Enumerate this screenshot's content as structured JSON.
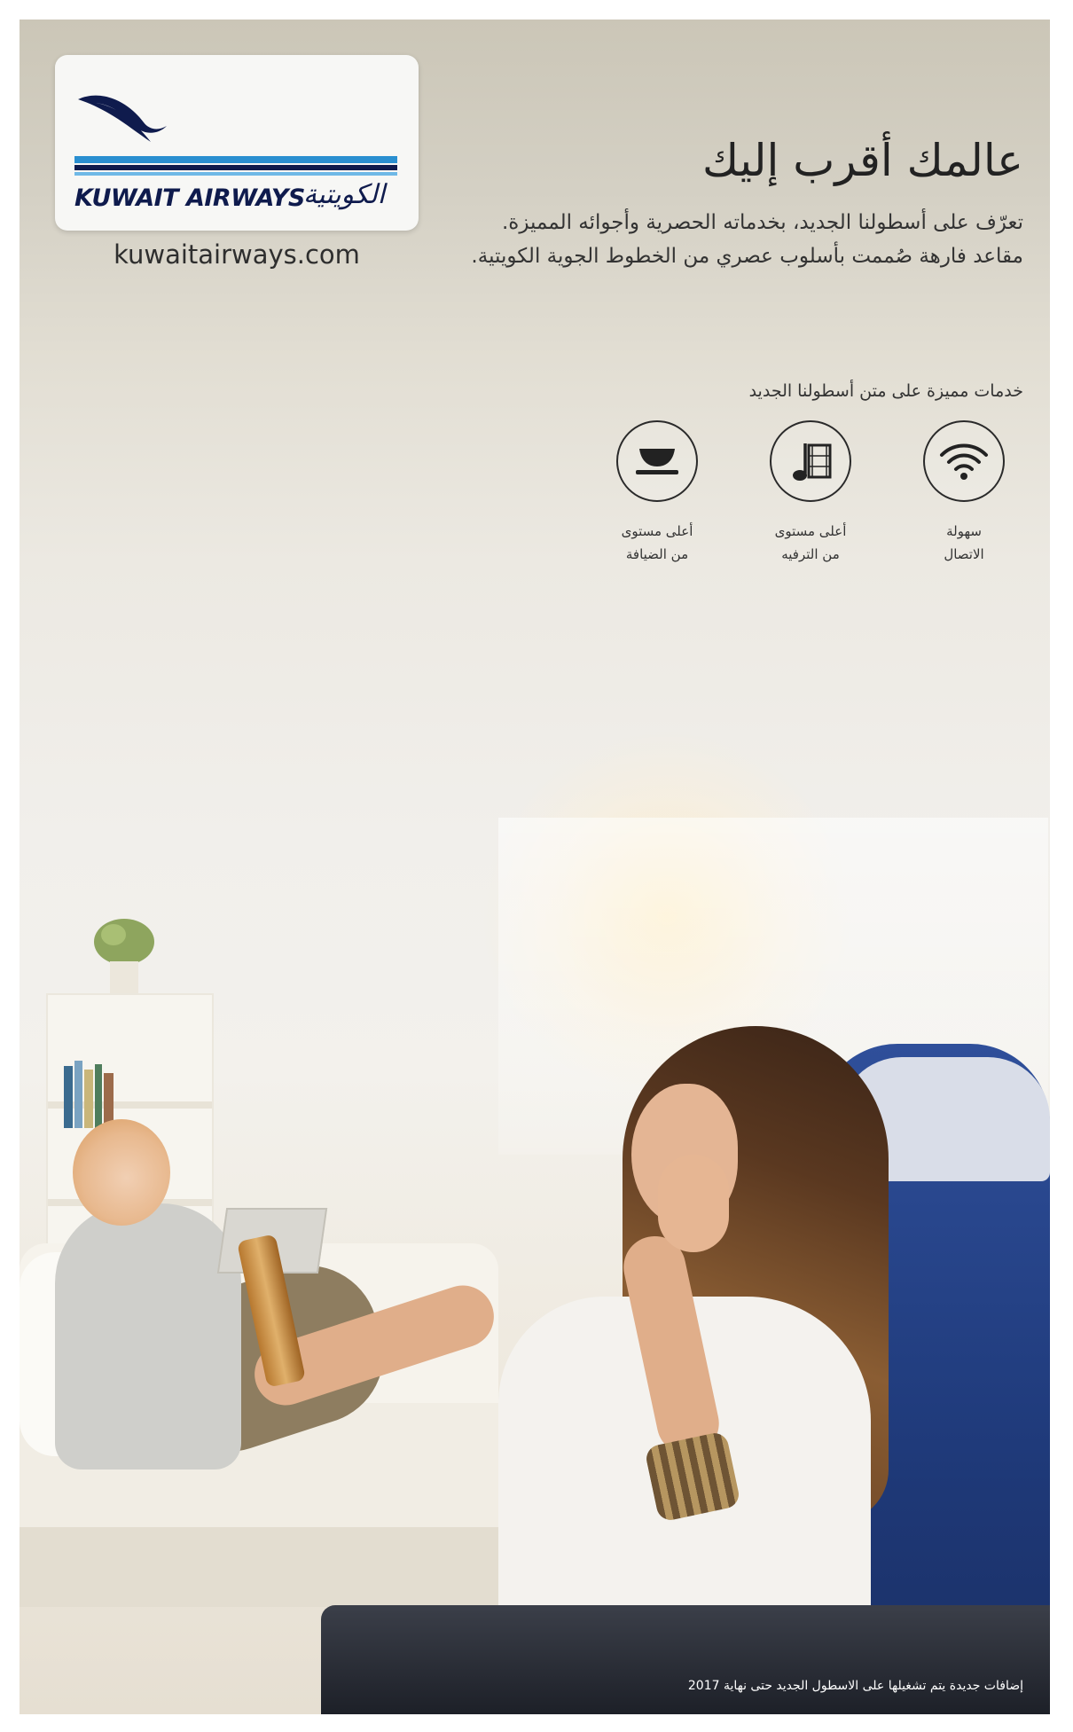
{
  "logo": {
    "brand_en": "KUWAIT AIRWAYS",
    "brand_ar": "الكويتية",
    "colors": {
      "navy": "#0f1b4d",
      "blue": "#2a8fd0",
      "light_blue": "#6fb8e6"
    }
  },
  "website": "kuwaitairways.com",
  "headline": "عالمك أقرب إليك",
  "intro": {
    "line1": "تعرّف على أسطولنا الجديد، بخدماته الحصرية وأجوائه المميزة.",
    "line2": "مقاعد فارهة صُممت بأسلوب عصري من الخطوط الجوية الكويتية."
  },
  "services": {
    "title": "خدمات مميزة على متن أسطولنا الجديد",
    "items": [
      {
        "icon": "wifi-icon",
        "line1": "سهولة",
        "line2": "الاتصال"
      },
      {
        "icon": "music-film-icon",
        "line1": "أعلى مستوى",
        "line2": "من الترفيه"
      },
      {
        "icon": "dining-bowl-icon",
        "line1": "أعلى مستوى",
        "line2": "من الضيافة"
      }
    ]
  },
  "footer_note": "إضافات جديدة يتم تشغيلها على الاسطول الجديد حتى نهاية 2017"
}
